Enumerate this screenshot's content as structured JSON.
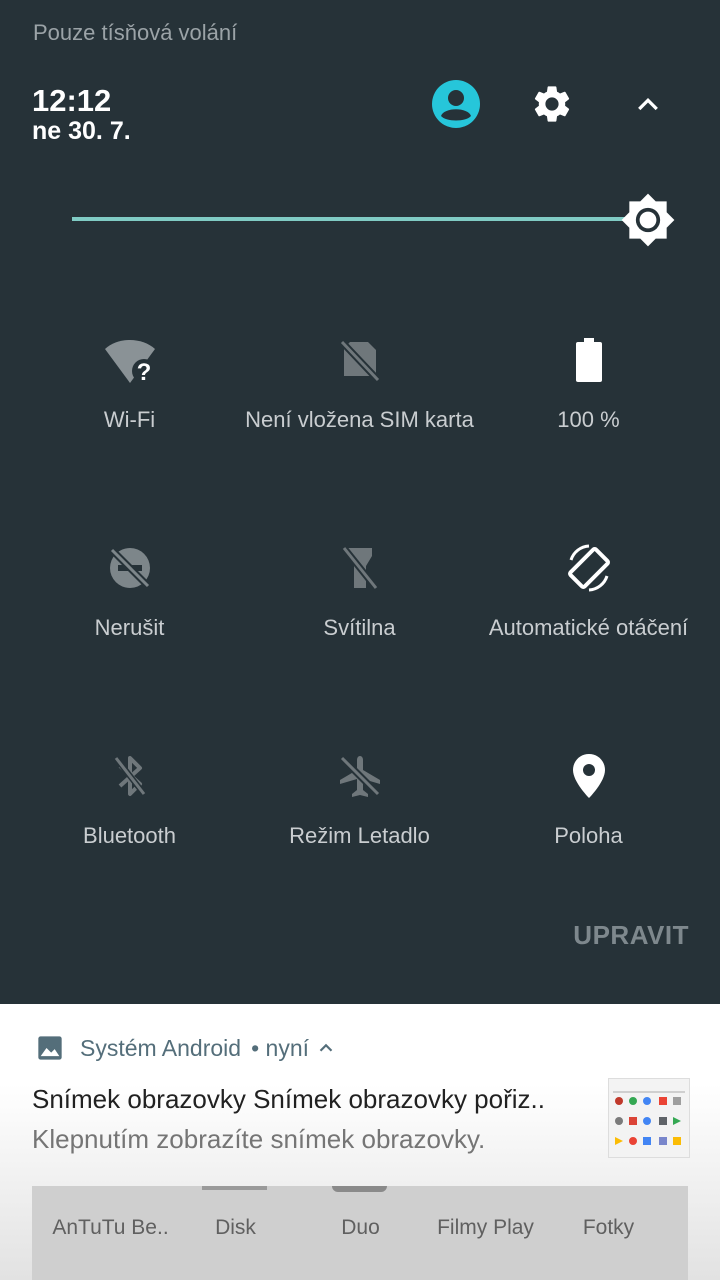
{
  "status": {
    "text": "Pouze tísňová volání"
  },
  "header": {
    "time": "12:12",
    "date": "ne 30. 7."
  },
  "brightness": {
    "level": 0.94
  },
  "tiles": [
    {
      "label": "Wi-Fi",
      "icon": "wifi-unknown-icon"
    },
    {
      "label": "Není vložena SIM karta",
      "icon": "no-sim-icon"
    },
    {
      "label": "100 %",
      "icon": "battery-full-icon"
    },
    {
      "label": "Nerušit",
      "icon": "do-not-disturb-off-icon"
    },
    {
      "label": "Svítilna",
      "icon": "flashlight-off-icon"
    },
    {
      "label": "Automatické otáčení",
      "icon": "auto-rotate-icon"
    },
    {
      "label": "Bluetooth",
      "icon": "bluetooth-off-icon"
    },
    {
      "label": "Režim Letadlo",
      "icon": "airplane-off-icon"
    },
    {
      "label": "Poloha",
      "icon": "location-icon"
    }
  ],
  "edit": {
    "label": "UPRAVIT"
  },
  "notification": {
    "app": "Systém Android",
    "when": "• nyní",
    "title": "Snímek obrazovky Snímek obrazovky pořiz..",
    "body": "Klepnutím zobrazíte snímek obrazovky.",
    "preview_apps": [
      "AnTuTu Be..",
      "Disk",
      "Duo",
      "Filmy Play",
      "Fotky"
    ]
  },
  "colors": {
    "shade_bg": "#263238",
    "accent": "#80cbc4",
    "avatar": "#26c6da"
  }
}
